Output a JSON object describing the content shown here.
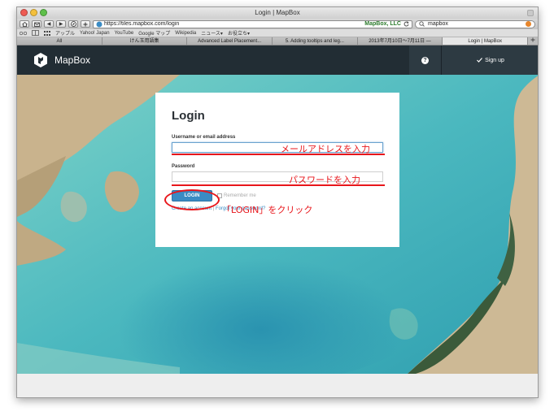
{
  "browser": {
    "window_title": "Login | MapBox",
    "nav_back": "◀",
    "nav_forward": "▶",
    "url": "https://tiles.mapbox.com/login",
    "cert_owner": "MapBox, LLC",
    "search_value": "mapbox",
    "bookmarks": [
      "アップル",
      "Yahoo! Japan",
      "YouTube",
      "Google マップ",
      "Wikipedia",
      "ニュース▾",
      "お役立ち▾"
    ],
    "tabs": [
      "All",
      "けん玉用語集",
      "Advanced Label Placement...",
      "5. Adding tooltips and leg...",
      "2013年7月10日〜7月11日 —",
      "Login | MapBox"
    ],
    "active_tab_index": 5
  },
  "navbar": {
    "brand": "MapBox",
    "help_label": "?",
    "signup_label": "Sign up",
    "colors": {
      "bg": "#222d34",
      "accent": "#3a8bc4"
    }
  },
  "login": {
    "title": "Login",
    "username_label": "Username or email address",
    "username_value": "",
    "password_label": "Password",
    "password_value": "",
    "button_label": "LOGIN",
    "remember_label": "Remember me",
    "create_account": "Create an account",
    "separator": "|",
    "forgot_password": "Forgot your password?"
  },
  "annotations": {
    "email_hint": "メールアドレスを入力",
    "password_hint": "パスワードを入力",
    "login_hint": "「LOGIN」をクリック",
    "color": "#e8161b"
  }
}
